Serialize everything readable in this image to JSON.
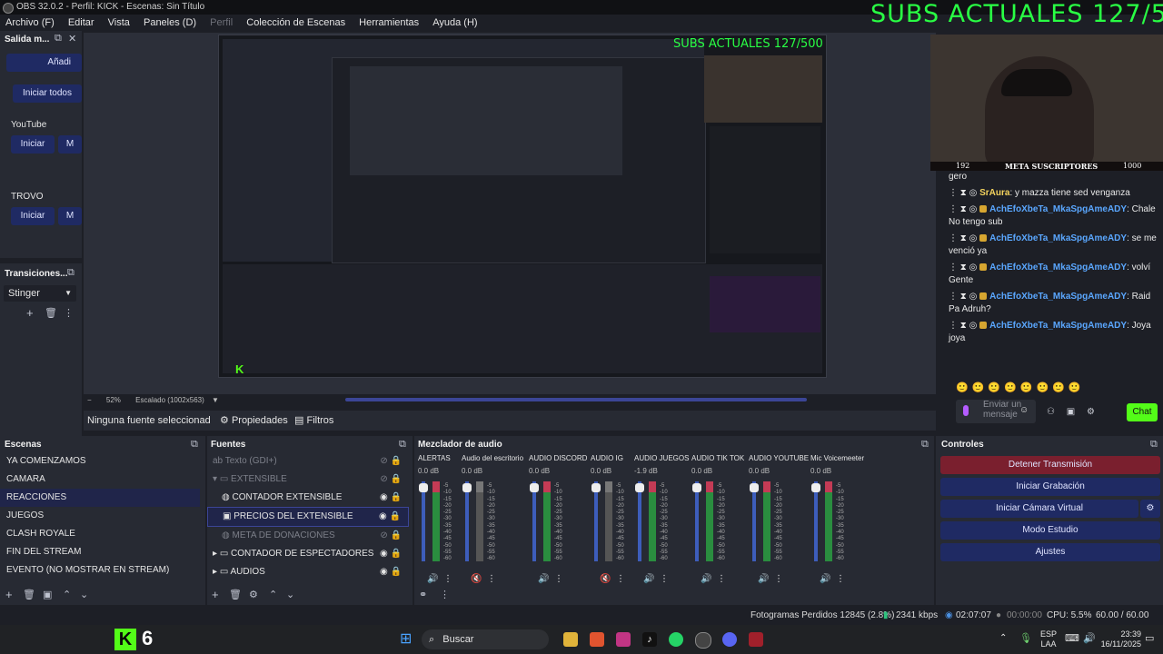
{
  "title": "OBS 32.0.2 - Perfil: KICK - Escenas: Sin Título",
  "menu": [
    "Archivo (F)",
    "Editar",
    "Vista",
    "Paneles (D)",
    "Perfil",
    "Colección de Escenas",
    "Herramientas",
    "Ayuda (H)"
  ],
  "overlay_text": "SUBS ACTUALES 127/500",
  "output_panel": {
    "title": "Salida m...",
    "add": "Añadi",
    "start_all": "Iniciar todos",
    "youtube": "YouTube",
    "trovo": "TROVO",
    "start": "Iniciar"
  },
  "transitions": {
    "title": "Transiciones...",
    "selected": "Stinger"
  },
  "preview": {
    "zoom": "52%",
    "scaled": "Escalado (1002x563)"
  },
  "source_bar": {
    "none_selected": "Ninguna fuente seleccionad",
    "properties": "Propiedades",
    "filters": "Filtros"
  },
  "scenes": {
    "title": "Escenas",
    "items": [
      "YA COMENZAMOS",
      "CAMARA",
      "REACCIONES",
      "JUEGOS",
      "CLASH ROYALE",
      "FIN DEL STREAM",
      "EVENTO (NO MOSTRAR EN STREAM)"
    ],
    "selected_index": 2
  },
  "sources": {
    "title": "Fuentes",
    "items": [
      {
        "label": "Texto (GDI+)",
        "hidden": true
      },
      {
        "label": "EXTENSIBLE",
        "hidden": true,
        "group": true
      },
      {
        "label": "CONTADOR EXTENSIBLE",
        "hidden": false
      },
      {
        "label": "PRECIOS DEL EXTENSIBLE",
        "hidden": false,
        "selected": true
      },
      {
        "label": "META DE DONACIONES",
        "hidden": true
      },
      {
        "label": "CONTADOR DE ESPECTADORES",
        "hidden": false,
        "group": true
      },
      {
        "label": "AUDIOS",
        "hidden": false,
        "group": true
      }
    ]
  },
  "mixer": {
    "title": "Mezclador de audio",
    "channels": [
      {
        "name": "ALERTAS",
        "db": "0.0 dB",
        "muted": false
      },
      {
        "name": "Audio del escritorio",
        "db": "0.0 dB",
        "muted": true
      },
      {
        "name": "AUDIO DISCORD",
        "db": "0.0 dB",
        "muted": false
      },
      {
        "name": "AUDIO IG",
        "db": "0.0 dB",
        "muted": true
      },
      {
        "name": "AUDIO JUEGOS",
        "db": "-1.9 dB",
        "muted": false
      },
      {
        "name": "AUDIO TIK TOK",
        "db": "0.0 dB",
        "muted": false
      },
      {
        "name": "AUDIO YOUTUBE",
        "db": "0.0 dB",
        "muted": false
      },
      {
        "name": "Mic Voicemeeter",
        "db": "0.0 dB",
        "muted": false
      }
    ],
    "scale": [
      "-5",
      "-10",
      "-15",
      "-20",
      "-25",
      "-30",
      "-35",
      "-40",
      "-45",
      "-50",
      "-55",
      "-60"
    ]
  },
  "controls": {
    "title": "Controles",
    "stop_stream": "Detener Transmisión",
    "start_record": "Iniciar Grabación",
    "start_vcam": "Iniciar Cámara Virtual",
    "studio": "Modo Estudio",
    "settings": "Ajustes"
  },
  "chat": {
    "meta": "META SUSCRIPTORES",
    "count_left": "192",
    "count_right": "1000",
    "messages": [
      {
        "user": "",
        "text": "gero"
      },
      {
        "user": "SrAura",
        "text": ": y mazza tiene sed venganza"
      },
      {
        "user": "AchEfoXbeTa_MkaSpgAmeADY",
        "text": ": Chale No tengo sub"
      },
      {
        "user": "AchEfoXbeTa_MkaSpgAmeADY",
        "text": ": se me venció ya"
      },
      {
        "user": "AchEfoXbeTa_MkaSpgAmeADY",
        "text": ": volví Gente"
      },
      {
        "user": "AchEfoXbeTa_MkaSpgAmeADY",
        "text": ": Raid Pa Adruh?"
      },
      {
        "user": "AchEfoXbeTa_MkaSpgAmeADY",
        "text": ": Joya joya"
      }
    ],
    "input_placeholder": "Enviar un mensaje",
    "chat_button": "Chat"
  },
  "status": {
    "dropped": "Fotogramas Perdidos 12845 (2.8%)",
    "kbps": "2341 kbps",
    "stream_time": "02:07:07",
    "rec_time": "00:00:00",
    "cpu": "CPU: 5.5%",
    "fps": "60.00 / 60.00 FPS"
  },
  "taskbar": {
    "search": "Buscar",
    "lang": "ESP",
    "lang2": "LAA",
    "time": "23:39",
    "date": "16/11/2025",
    "kick_count": "6"
  },
  "colors": {
    "accent_blue": "#1f2a63",
    "stop_red": "#7a1f2e",
    "overlay_green": "#29ff44",
    "chat_green": "#53fc18"
  }
}
